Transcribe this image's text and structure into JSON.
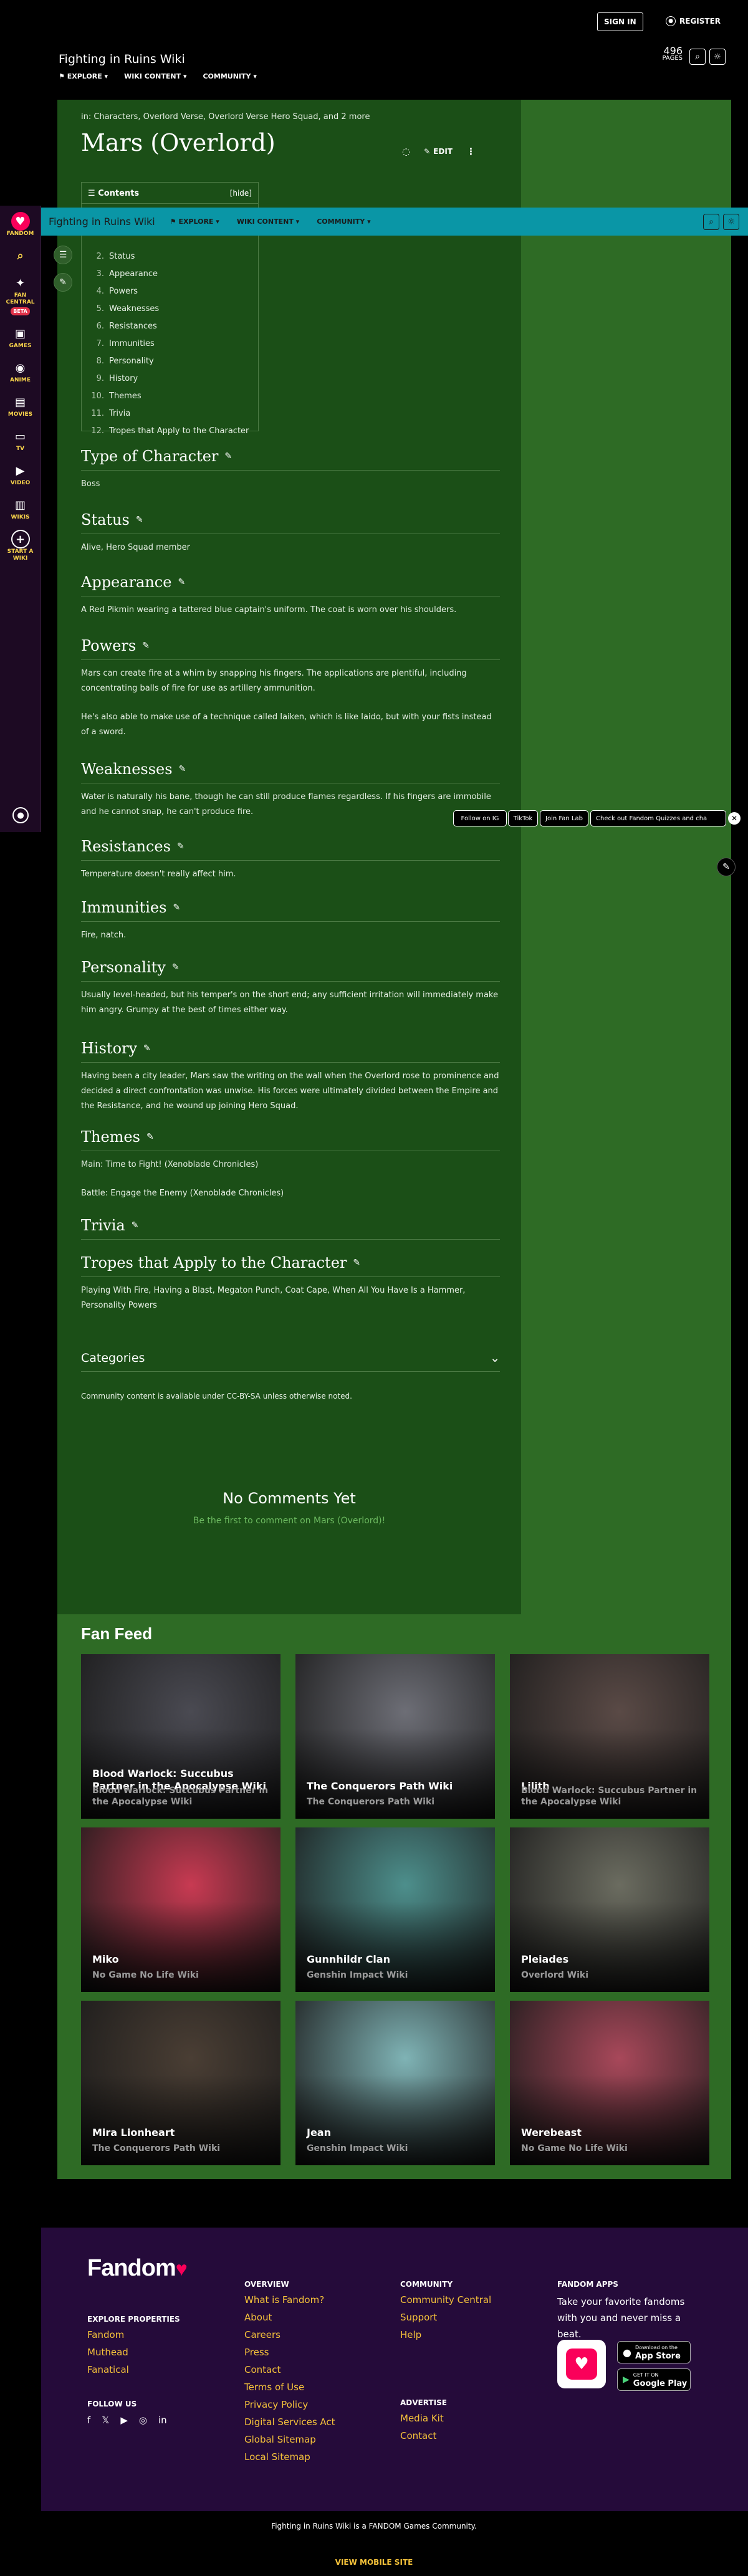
{
  "header": {
    "sign_in": "SIGN IN",
    "register": "REGISTER",
    "wiki_title": "Fighting in Ruins Wiki",
    "nav": [
      "EXPLORE",
      "WIKI CONTENT",
      "COMMUNITY"
    ],
    "pages_count": "496",
    "pages_label": "PAGES"
  },
  "rail": {
    "items": [
      {
        "label": "FANDOM",
        "icon": "fandom-flame-icon"
      },
      {
        "label": "",
        "icon": "search-icon"
      },
      {
        "label": "FAN CENTRAL",
        "badge": "BETA",
        "icon": "fan-central-icon"
      },
      {
        "label": "GAMES",
        "icon": "gamepad-icon"
      },
      {
        "label": "ANIME",
        "icon": "anime-icon"
      },
      {
        "label": "MOVIES",
        "icon": "movies-icon"
      },
      {
        "label": "TV",
        "icon": "tv-icon"
      },
      {
        "label": "VIDEO",
        "icon": "video-icon"
      },
      {
        "label": "WIKIS",
        "icon": "wikis-icon"
      },
      {
        "label": "START A WIKI",
        "icon": "plus-icon"
      }
    ]
  },
  "article": {
    "breadcrumb": "in: Characters, Overlord Verse, Overlord Verse Hero Squad, and 2 more",
    "title": "Mars (Overlord)",
    "edit_label": "EDIT",
    "toc_title": "Contents",
    "toc_hide": "[hide]",
    "toc": [
      {
        "num": "2.",
        "label": "Status"
      },
      {
        "num": "3.",
        "label": "Appearance"
      },
      {
        "num": "4.",
        "label": "Powers"
      },
      {
        "num": "5.",
        "label": "Weaknesses"
      },
      {
        "num": "6.",
        "label": "Resistances"
      },
      {
        "num": "7.",
        "label": "Immunities"
      },
      {
        "num": "8.",
        "label": "Personality"
      },
      {
        "num": "9.",
        "label": "History"
      },
      {
        "num": "10.",
        "label": "Themes"
      },
      {
        "num": "11.",
        "label": "Trivia"
      },
      {
        "num": "12.",
        "label": "Tropes that Apply to the Character"
      }
    ],
    "sections": [
      {
        "heading": "Type of Character",
        "paras": [
          "Boss"
        ]
      },
      {
        "heading": "Status",
        "paras": [
          "Alive, Hero Squad member"
        ]
      },
      {
        "heading": "Appearance",
        "paras": [
          "A Red Pikmin wearing a tattered blue captain's uniform. The coat is worn over his shoulders."
        ]
      },
      {
        "heading": "Powers",
        "paras": [
          "Mars can create fire at a whim by snapping his fingers. The applications are plentiful, including concentrating balls of fire for use as artillery ammunition.",
          "He's also able to make use of a technique called Iaiken, which is like Iaido, but with your fists instead of a sword."
        ]
      },
      {
        "heading": "Weaknesses",
        "paras": [
          "Water is naturally his bane, though he can still produce flames regardless. If his fingers are immobile and he cannot snap, he can't produce fire."
        ]
      },
      {
        "heading": "Resistances",
        "paras": [
          "Temperature doesn't really affect him."
        ]
      },
      {
        "heading": "Immunities",
        "paras": [
          "Fire, natch."
        ]
      },
      {
        "heading": "Personality",
        "paras": [
          "Usually level-headed, but his temper's on the short end; any sufficient irritation will immediately make him angry. Grumpy at the best of times either way."
        ]
      },
      {
        "heading": "History",
        "paras": [
          "Having been a city leader, Mars saw the writing on the wall when the Overlord rose to prominence and decided a direct confrontation was unwise. His forces were ultimately divided between the Empire and the Resistance, and he wound up joining Hero Squad."
        ]
      },
      {
        "heading": "Themes",
        "paras": [
          "Main: Time to Fight! (Xenoblade Chronicles)",
          "Battle: Engage the Enemy (Xenoblade Chronicles)"
        ]
      },
      {
        "heading": "Trivia",
        "paras": []
      },
      {
        "heading": "Tropes that Apply to the Character",
        "paras": [
          "Playing With Fire, Having a Blast, Megaton Punch, Coat Cape, When All You Have Is a Hammer, Personality Powers"
        ]
      }
    ],
    "categories": "Categories",
    "license": "Community content is available under CC-BY-SA unless otherwise noted."
  },
  "comments": {
    "heading": "No Comments Yet",
    "sub": "Be the first to comment on Mars (Overlord)!"
  },
  "promo": {
    "items": [
      "Follow on IG",
      "TikTok",
      "Join Fan Lab",
      "Check out Fandom Quizzes and cha"
    ]
  },
  "fan_feed": {
    "title": "Fan Feed",
    "cards": [
      {
        "title": "Blood Warlock: Succubus Partner in the Apocalypse Wiki",
        "sub": "Blood Warlock: Succubus Partner in the Apocalypse Wiki",
        "color": "#4a4a52"
      },
      {
        "title": "The Conquerors Path Wiki",
        "sub": "The Conquerors Path Wiki",
        "color": "#6d6e76"
      },
      {
        "title": "Lilith",
        "sub": "Blood Warlock: Succubus Partner in the Apocalypse Wiki",
        "color": "#5a4a46"
      },
      {
        "title": "Miko",
        "sub": "No Game No Life Wiki",
        "color": "#c83a52"
      },
      {
        "title": "Gunnhildr Clan",
        "sub": "Genshin Impact Wiki",
        "color": "#4d8f8c"
      },
      {
        "title": "Pleiades",
        "sub": "Overlord Wiki",
        "color": "#6b6c60"
      },
      {
        "title": "Mira Lionheart",
        "sub": "The Conquerors Path Wiki",
        "color": "#4a3e34"
      },
      {
        "title": "Jean",
        "sub": "Genshin Impact Wiki",
        "color": "#7fb3b5"
      },
      {
        "title": "Werebeast",
        "sub": "No Game No Life Wiki",
        "color": "#a8485a"
      }
    ]
  },
  "footer": {
    "logo": "Fandom",
    "explore_title": "EXPLORE PROPERTIES",
    "explore": [
      "Fandom",
      "Muthead",
      "Fanatical"
    ],
    "follow_title": "FOLLOW US",
    "overview_title": "OVERVIEW",
    "overview": [
      "What is Fandom?",
      "About",
      "Careers",
      "Press",
      "Contact",
      "Terms of Use",
      "Privacy Policy",
      "Digital Services Act",
      "Global Sitemap",
      "Local Sitemap"
    ],
    "community_title": "COMMUNITY",
    "community": [
      "Community Central",
      "Support",
      "Help"
    ],
    "advertise_title": "ADVERTISE",
    "advertise": [
      "Media Kit",
      "Contact"
    ],
    "apps_title": "FANDOM APPS",
    "apps_text": "Take your favorite fandoms with you and never miss a beat.",
    "app_store": "App Store",
    "app_store_small": "Download on the",
    "google_play": "Google Play",
    "google_play_small": "GET IT ON",
    "bottom": "Fighting in Ruins Wiki is a FANDOM Games Community.",
    "mobile": "VIEW MOBILE SITE"
  },
  "colors": {
    "page_bg": "#1b4f17",
    "accent": "#0a96a6",
    "footer": "#250b3a",
    "link": "#f5c23a"
  }
}
